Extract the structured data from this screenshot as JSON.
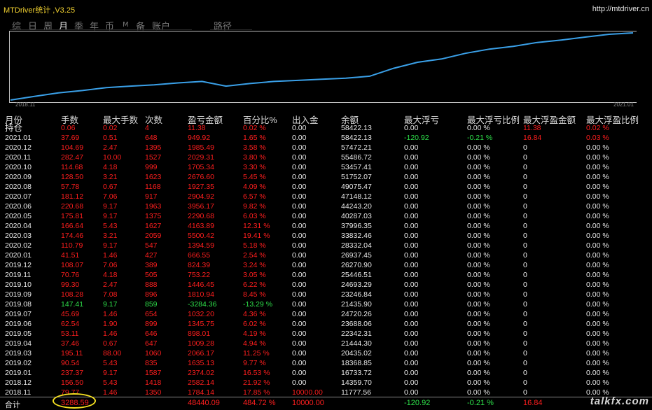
{
  "app": {
    "title": "MTDriver统计 ,V3.25",
    "url": "http://mtdriver.cn"
  },
  "periods": {
    "items": [
      "综",
      "日",
      "周",
      "月",
      "季",
      "年",
      "币",
      "M",
      "备",
      "账户",
      "路径"
    ],
    "active": "月"
  },
  "chart": {
    "start_label": "2018.11",
    "end_label": "2021.01",
    "line_color": "#3aa0e8",
    "frame_color": "#bdbdbd"
  },
  "chart_data": {
    "type": "line",
    "x": [
      "2018.11",
      "2018.12",
      "2019.01",
      "2019.02",
      "2019.03",
      "2019.04",
      "2019.05",
      "2019.06",
      "2019.07",
      "2019.08",
      "2019.09",
      "2019.10",
      "2019.11",
      "2019.12",
      "2020.01",
      "2020.02",
      "2020.03",
      "2020.04",
      "2020.05",
      "2020.06",
      "2020.07",
      "2020.08",
      "2020.09",
      "2020.10",
      "2020.11",
      "2020.12",
      "2021.01"
    ],
    "series": [
      {
        "values": [
          11777.56,
          14359.7,
          16733.72,
          18368.85,
          20435.02,
          21444.3,
          22342.31,
          23688.06,
          24720.26,
          21435.9,
          23246.84,
          24693.29,
          25446.51,
          26270.9,
          26937.45,
          28332.04,
          33832.46,
          37996.35,
          40287.03,
          44243.2,
          47148.12,
          49075.47,
          51752.07,
          53457.41,
          55486.72,
          57472.21,
          58422.13
        ]
      }
    ]
  },
  "table": {
    "headers": [
      "月份",
      "手数",
      "最大手数",
      "次数",
      "盈亏金额",
      "百分比%",
      "出入金",
      "余额",
      "最大浮亏",
      "最大浮亏比例",
      "最大浮盈金额",
      "最大浮盈比例"
    ],
    "rows": [
      {
        "c": [
          "持仓",
          "0.06",
          "0.02",
          "4",
          "11.38",
          "0.02 %",
          "0.00",
          "58422.13",
          "0.00",
          "0.00 %",
          "11.38",
          "0.02 %"
        ],
        "k": [
          "w",
          "r",
          "r",
          "r",
          "r",
          "r",
          "w",
          "w",
          "w",
          "w",
          "r",
          "r"
        ]
      },
      {
        "c": [
          "2021.01",
          "37.69",
          "0.51",
          "648",
          "949.92",
          "1.65 %",
          "0.00",
          "58422.13",
          "-120.92",
          "-0.21 %",
          "16.84",
          "0.03 %"
        ],
        "k": [
          "w",
          "r",
          "r",
          "r",
          "r",
          "r",
          "w",
          "w",
          "g",
          "g",
          "r",
          "r"
        ]
      },
      {
        "c": [
          "2020.12",
          "104.69",
          "2.47",
          "1395",
          "1985.49",
          "3.58 %",
          "0.00",
          "57472.21",
          "0.00",
          "0.00 %",
          "0",
          "0.00 %"
        ],
        "k": [
          "w",
          "r",
          "r",
          "r",
          "r",
          "r",
          "w",
          "w",
          "w",
          "w",
          "w",
          "w"
        ]
      },
      {
        "c": [
          "2020.11",
          "282.47",
          "10.00",
          "1527",
          "2029.31",
          "3.80 %",
          "0.00",
          "55486.72",
          "0.00",
          "0.00 %",
          "0",
          "0.00 %"
        ],
        "k": [
          "w",
          "r",
          "r",
          "r",
          "r",
          "r",
          "w",
          "w",
          "w",
          "w",
          "w",
          "w"
        ]
      },
      {
        "c": [
          "2020.10",
          "114.68",
          "4.18",
          "999",
          "1705.34",
          "3.30 %",
          "0.00",
          "53457.41",
          "0.00",
          "0.00 %",
          "0",
          "0.00 %"
        ],
        "k": [
          "w",
          "r",
          "r",
          "r",
          "r",
          "r",
          "w",
          "w",
          "w",
          "w",
          "w",
          "w"
        ]
      },
      {
        "c": [
          "2020.09",
          "128.50",
          "3.21",
          "1623",
          "2676.60",
          "5.45 %",
          "0.00",
          "51752.07",
          "0.00",
          "0.00 %",
          "0",
          "0.00 %"
        ],
        "k": [
          "w",
          "r",
          "r",
          "r",
          "r",
          "r",
          "w",
          "w",
          "w",
          "w",
          "w",
          "w"
        ]
      },
      {
        "c": [
          "2020.08",
          "57.78",
          "0.67",
          "1168",
          "1927.35",
          "4.09 %",
          "0.00",
          "49075.47",
          "0.00",
          "0.00 %",
          "0",
          "0.00 %"
        ],
        "k": [
          "w",
          "r",
          "r",
          "r",
          "r",
          "r",
          "w",
          "w",
          "w",
          "w",
          "w",
          "w"
        ]
      },
      {
        "c": [
          "2020.07",
          "181.12",
          "7.06",
          "917",
          "2904.92",
          "6.57 %",
          "0.00",
          "47148.12",
          "0.00",
          "0.00 %",
          "0",
          "0.00 %"
        ],
        "k": [
          "w",
          "r",
          "r",
          "r",
          "r",
          "r",
          "w",
          "w",
          "w",
          "w",
          "w",
          "w"
        ]
      },
      {
        "c": [
          "2020.06",
          "220.68",
          "9.17",
          "1963",
          "3956.17",
          "9.82 %",
          "0.00",
          "44243.20",
          "0.00",
          "0.00 %",
          "0",
          "0.00 %"
        ],
        "k": [
          "w",
          "r",
          "r",
          "r",
          "r",
          "r",
          "w",
          "w",
          "w",
          "w",
          "w",
          "w"
        ]
      },
      {
        "c": [
          "2020.05",
          "175.81",
          "9.17",
          "1375",
          "2290.68",
          "6.03 %",
          "0.00",
          "40287.03",
          "0.00",
          "0.00 %",
          "0",
          "0.00 %"
        ],
        "k": [
          "w",
          "r",
          "r",
          "r",
          "r",
          "r",
          "w",
          "w",
          "w",
          "w",
          "w",
          "w"
        ]
      },
      {
        "c": [
          "2020.04",
          "166.64",
          "5.43",
          "1627",
          "4163.89",
          "12.31 %",
          "0.00",
          "37996.35",
          "0.00",
          "0.00 %",
          "0",
          "0.00 %"
        ],
        "k": [
          "w",
          "r",
          "r",
          "r",
          "r",
          "r",
          "w",
          "w",
          "w",
          "w",
          "w",
          "w"
        ]
      },
      {
        "c": [
          "2020.03",
          "174.46",
          "3.21",
          "2059",
          "5500.42",
          "19.41 %",
          "0.00",
          "33832.46",
          "0.00",
          "0.00 %",
          "0",
          "0.00 %"
        ],
        "k": [
          "w",
          "r",
          "r",
          "r",
          "r",
          "r",
          "w",
          "w",
          "w",
          "w",
          "w",
          "w"
        ]
      },
      {
        "c": [
          "2020.02",
          "110.79",
          "9.17",
          "547",
          "1394.59",
          "5.18 %",
          "0.00",
          "28332.04",
          "0.00",
          "0.00 %",
          "0",
          "0.00 %"
        ],
        "k": [
          "w",
          "r",
          "r",
          "r",
          "r",
          "r",
          "w",
          "w",
          "w",
          "w",
          "w",
          "w"
        ]
      },
      {
        "c": [
          "2020.01",
          "41.51",
          "1.46",
          "427",
          "666.55",
          "2.54 %",
          "0.00",
          "26937.45",
          "0.00",
          "0.00 %",
          "0",
          "0.00 %"
        ],
        "k": [
          "w",
          "r",
          "r",
          "r",
          "r",
          "r",
          "w",
          "w",
          "w",
          "w",
          "w",
          "w"
        ]
      },
      {
        "c": [
          "2019.12",
          "108.07",
          "7.06",
          "389",
          "824.39",
          "3.24 %",
          "0.00",
          "26270.90",
          "0.00",
          "0.00 %",
          "0",
          "0.00 %"
        ],
        "k": [
          "w",
          "r",
          "r",
          "r",
          "r",
          "r",
          "w",
          "w",
          "w",
          "w",
          "w",
          "w"
        ]
      },
      {
        "c": [
          "2019.11",
          "70.76",
          "4.18",
          "505",
          "753.22",
          "3.05 %",
          "0.00",
          "25446.51",
          "0.00",
          "0.00 %",
          "0",
          "0.00 %"
        ],
        "k": [
          "w",
          "r",
          "r",
          "r",
          "r",
          "r",
          "w",
          "w",
          "w",
          "w",
          "w",
          "w"
        ]
      },
      {
        "c": [
          "2019.10",
          "99.30",
          "2.47",
          "888",
          "1446.45",
          "6.22 %",
          "0.00",
          "24693.29",
          "0.00",
          "0.00 %",
          "0",
          "0.00 %"
        ],
        "k": [
          "w",
          "r",
          "r",
          "r",
          "r",
          "r",
          "w",
          "w",
          "w",
          "w",
          "w",
          "w"
        ]
      },
      {
        "c": [
          "2019.09",
          "108.28",
          "7.08",
          "896",
          "1810.94",
          "8.45 %",
          "0.00",
          "23246.84",
          "0.00",
          "0.00 %",
          "0",
          "0.00 %"
        ],
        "k": [
          "w",
          "r",
          "r",
          "r",
          "r",
          "r",
          "w",
          "w",
          "w",
          "w",
          "w",
          "w"
        ]
      },
      {
        "c": [
          "2019.08",
          "147.41",
          "9.17",
          "859",
          "-3284.36",
          "-13.29 %",
          "0.00",
          "21435.90",
          "0.00",
          "0.00 %",
          "0",
          "0.00 %"
        ],
        "k": [
          "w",
          "g",
          "g",
          "g",
          "g",
          "g",
          "w",
          "w",
          "w",
          "w",
          "w",
          "w"
        ]
      },
      {
        "c": [
          "2019.07",
          "45.69",
          "1.46",
          "654",
          "1032.20",
          "4.36 %",
          "0.00",
          "24720.26",
          "0.00",
          "0.00 %",
          "0",
          "0.00 %"
        ],
        "k": [
          "w",
          "r",
          "r",
          "r",
          "r",
          "r",
          "w",
          "w",
          "w",
          "w",
          "w",
          "w"
        ]
      },
      {
        "c": [
          "2019.06",
          "62.54",
          "1.90",
          "899",
          "1345.75",
          "6.02 %",
          "0.00",
          "23688.06",
          "0.00",
          "0.00 %",
          "0",
          "0.00 %"
        ],
        "k": [
          "w",
          "r",
          "r",
          "r",
          "r",
          "r",
          "w",
          "w",
          "w",
          "w",
          "w",
          "w"
        ]
      },
      {
        "c": [
          "2019.05",
          "53.11",
          "1.46",
          "646",
          "898.01",
          "4.19 %",
          "0.00",
          "22342.31",
          "0.00",
          "0.00 %",
          "0",
          "0.00 %"
        ],
        "k": [
          "w",
          "r",
          "r",
          "r",
          "r",
          "r",
          "w",
          "w",
          "w",
          "w",
          "w",
          "w"
        ]
      },
      {
        "c": [
          "2019.04",
          "37.46",
          "0.67",
          "647",
          "1009.28",
          "4.94 %",
          "0.00",
          "21444.30",
          "0.00",
          "0.00 %",
          "0",
          "0.00 %"
        ],
        "k": [
          "w",
          "r",
          "r",
          "r",
          "r",
          "r",
          "w",
          "w",
          "w",
          "w",
          "w",
          "w"
        ]
      },
      {
        "c": [
          "2019.03",
          "195.11",
          "88.00",
          "1060",
          "2066.17",
          "11.25 %",
          "0.00",
          "20435.02",
          "0.00",
          "0.00 %",
          "0",
          "0.00 %"
        ],
        "k": [
          "w",
          "r",
          "r",
          "r",
          "r",
          "r",
          "w",
          "w",
          "w",
          "w",
          "w",
          "w"
        ]
      },
      {
        "c": [
          "2019.02",
          "90.54",
          "5.43",
          "835",
          "1635.13",
          "9.77 %",
          "0.00",
          "18368.85",
          "0.00",
          "0.00 %",
          "0",
          "0.00 %"
        ],
        "k": [
          "w",
          "r",
          "r",
          "r",
          "r",
          "r",
          "w",
          "w",
          "w",
          "w",
          "w",
          "w"
        ]
      },
      {
        "c": [
          "2019.01",
          "237.37",
          "9.17",
          "1587",
          "2374.02",
          "16.53 %",
          "0.00",
          "16733.72",
          "0.00",
          "0.00 %",
          "0",
          "0.00 %"
        ],
        "k": [
          "w",
          "r",
          "r",
          "r",
          "r",
          "r",
          "w",
          "w",
          "w",
          "w",
          "w",
          "w"
        ]
      },
      {
        "c": [
          "2018.12",
          "156.50",
          "5.43",
          "1418",
          "2582.14",
          "21.92 %",
          "0.00",
          "14359.70",
          "0.00",
          "0.00 %",
          "0",
          "0.00 %"
        ],
        "k": [
          "w",
          "r",
          "r",
          "r",
          "r",
          "r",
          "w",
          "w",
          "w",
          "w",
          "w",
          "w"
        ]
      },
      {
        "c": [
          "2018.11",
          "79.77",
          "1.46",
          "1350",
          "1784.14",
          "17.85 %",
          "10000.00",
          "11777.56",
          "0.00",
          "0.00 %",
          "0",
          "0.00 %"
        ],
        "k": [
          "w",
          "r",
          "r",
          "r",
          "r",
          "r",
          "r",
          "w",
          "w",
          "w",
          "w",
          "w"
        ]
      }
    ]
  },
  "totals": {
    "label": "合计",
    "lots": "3288.59",
    "profit": "48440.09",
    "percent": "484.72 %",
    "deposits": "10000.00",
    "max_float_loss": "-120.92",
    "max_float_loss_pct": "-0.21 %",
    "max_float_profit": "16.84"
  },
  "watermark": "talkfx.com"
}
